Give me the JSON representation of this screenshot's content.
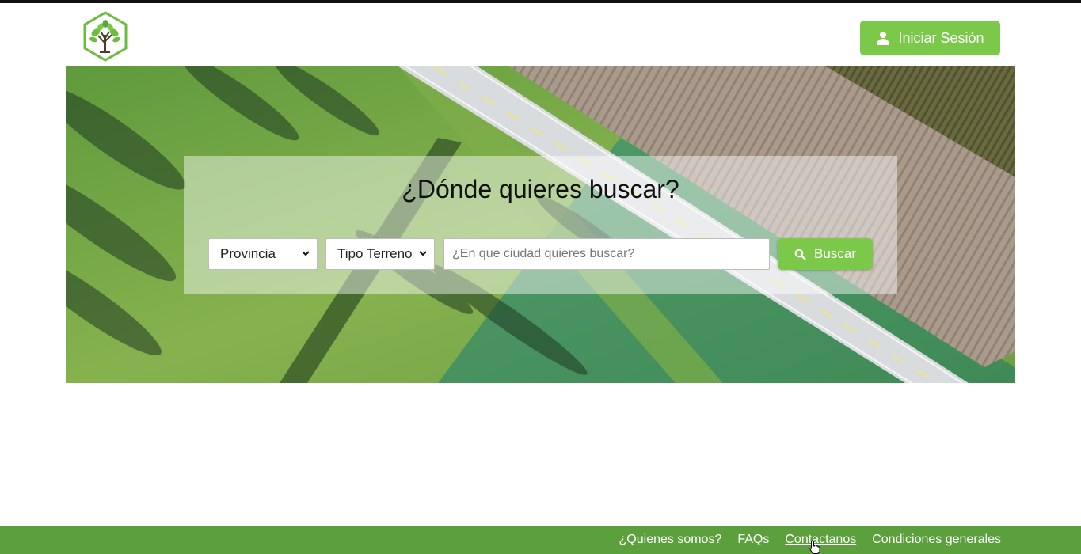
{
  "header": {
    "login_label": "Iniciar Sesión"
  },
  "search": {
    "title": "¿Dónde quieres buscar?",
    "province_select": "Provincia",
    "terrain_select": "Tipo Terreno",
    "city_placeholder": "¿En que ciudad quieres buscar?",
    "city_value": "",
    "button_label": "Buscar"
  },
  "footer": {
    "links": [
      "¿Quienes somos?",
      "FAQs",
      "Contactanos",
      "Condiciones generales"
    ]
  },
  "colors": {
    "brand_green": "#7cc84a",
    "footer_green": "#5ca03d"
  },
  "icons": {
    "logo": "tree-hexagon-logo-icon",
    "login": "user-icon",
    "search": "search-icon",
    "select_arrow": "chevron-down-icon"
  }
}
